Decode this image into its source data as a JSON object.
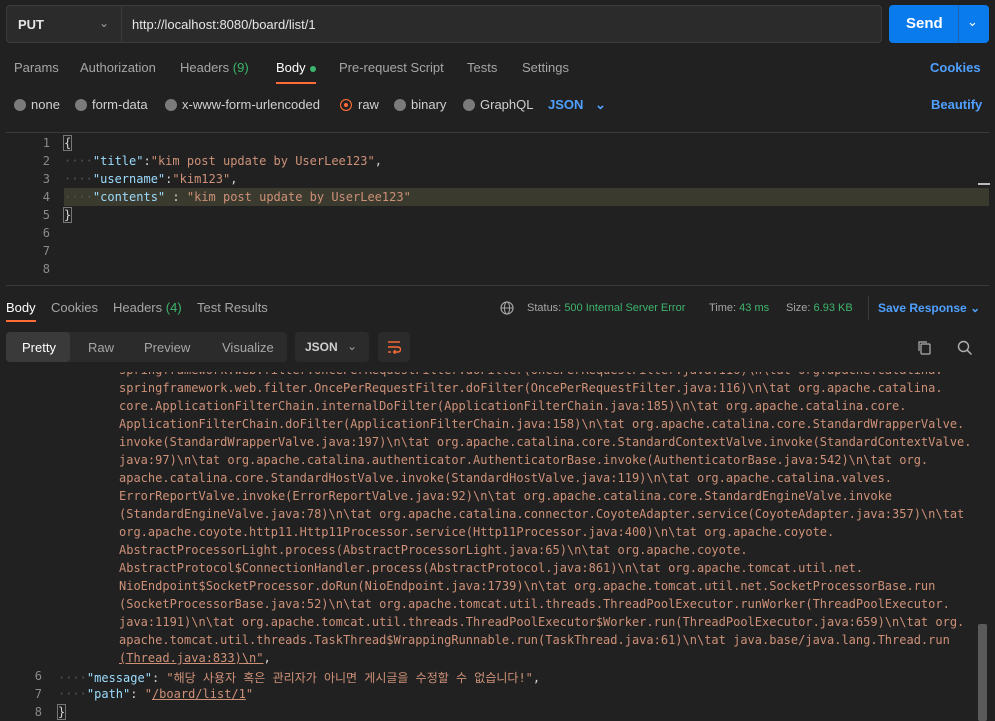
{
  "request": {
    "method": "PUT",
    "url": "http://localhost:8080/board/list/1",
    "send_label": "Send"
  },
  "req_tabs": {
    "params": "Params",
    "authorization": "Authorization",
    "headers": "Headers",
    "headers_count": "(9)",
    "body": "Body",
    "prerequest": "Pre-request Script",
    "tests": "Tests",
    "settings": "Settings",
    "cookies": "Cookies"
  },
  "body_types": {
    "none": "none",
    "form_data": "form-data",
    "urlencoded": "x-www-form-urlencoded",
    "raw": "raw",
    "binary": "binary",
    "graphql": "GraphQL",
    "language": "JSON",
    "beautify": "Beautify"
  },
  "editor": {
    "line_numbers": [
      "1",
      "2",
      "3",
      "4",
      "5",
      "6",
      "7",
      "8"
    ],
    "title_key": "\"title\"",
    "title_val": "\"kim post update by UserLee123\"",
    "username_key": "\"username\"",
    "username_val": "\"kim123\"",
    "contents_key": "\"contents\"",
    "contents_val": "\"kim post update by UserLee123\""
  },
  "resp_tabs": {
    "body": "Body",
    "cookies": "Cookies",
    "headers": "Headers",
    "headers_count": "(4)",
    "test_results": "Test Results"
  },
  "status": {
    "status_label": "Status:",
    "status_value": "500 Internal Server Error",
    "time_label": "Time:",
    "time_value": "43 ms",
    "size_label": "Size:",
    "size_value": "6.93 KB",
    "save_response": "Save Response"
  },
  "view": {
    "pretty": "Pretty",
    "raw": "Raw",
    "preview": "Preview",
    "visualize": "Visualize",
    "format": "JSON"
  },
  "response": {
    "trace_lines": [
      "springframework.web.filter.OncePerRequestFilter.doFilter(OncePerRequestFilter.java:116)\\n\\tat org.apache.catalina.",
      "core.ApplicationFilterChain.internalDoFilter(ApplicationFilterChain.java:185)\\n\\tat org.apache.catalina.core.",
      "ApplicationFilterChain.doFilter(ApplicationFilterChain.java:158)\\n\\tat org.apache.catalina.core.StandardWrapperValve.",
      "invoke(StandardWrapperValve.java:197)\\n\\tat org.apache.catalina.core.StandardContextValve.invoke(StandardContextValve.",
      "java:97)\\n\\tat org.apache.catalina.authenticator.AuthenticatorBase.invoke(AuthenticatorBase.java:542)\\n\\tat org.",
      "apache.catalina.core.StandardHostValve.invoke(StandardHostValve.java:119)\\n\\tat org.apache.catalina.valves.",
      "ErrorReportValve.invoke(ErrorReportValve.java:92)\\n\\tat org.apache.catalina.core.StandardEngineValve.invoke",
      "(StandardEngineValve.java:78)\\n\\tat org.apache.catalina.connector.CoyoteAdapter.service(CoyoteAdapter.java:357)\\n\\tat",
      "org.apache.coyote.http11.Http11Processor.service(Http11Processor.java:400)\\n\\tat org.apache.coyote.",
      "AbstractProcessorLight.process(AbstractProcessorLight.java:65)\\n\\tat org.apache.coyote.",
      "AbstractProtocol$ConnectionHandler.process(AbstractProtocol.java:861)\\n\\tat org.apache.tomcat.util.net.",
      "NioEndpoint$SocketProcessor.doRun(NioEndpoint.java:1739)\\n\\tat org.apache.tomcat.util.net.SocketProcessorBase.run",
      "(SocketProcessorBase.java:52)\\n\\tat org.apache.tomcat.util.threads.ThreadPoolExecutor.runWorker(ThreadPoolExecutor.",
      "java:1191)\\n\\tat org.apache.tomcat.util.threads.ThreadPoolExecutor$Worker.run(ThreadPoolExecutor.java:659)\\n\\tat org.",
      "apache.tomcat.util.threads.TaskThread$WrappingRunnable.run(TaskThread.java:61)\\n\\tat java.base/java.lang.Thread.run"
    ],
    "trace_last_prefix": "(Thread.java:833)\\n\"",
    "trace_last_suffix": ",",
    "message_key": "\"message\"",
    "message_val": "\"해당 사용자 혹은 관리자가 아니면 게시글을 수정할 수 없습니다!\"",
    "path_key": "\"path\"",
    "path_val_prefix": "\"",
    "path_val_link": "/board/list/1",
    "path_val_suffix": "\"",
    "line_numbers": [
      "6",
      "7",
      "8"
    ]
  }
}
